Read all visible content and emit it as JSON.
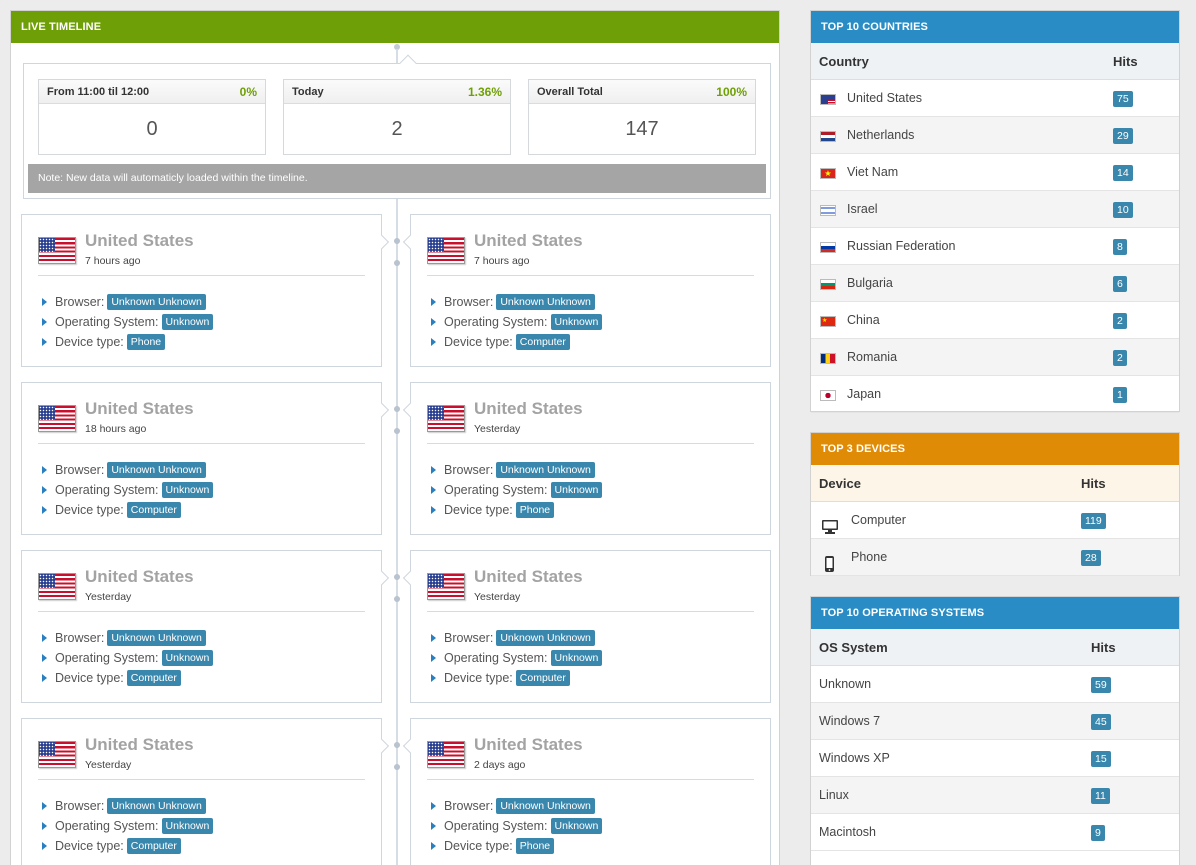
{
  "timeline": {
    "title": "LIVE TIMELINE",
    "stats": [
      {
        "label": "From 11:00 til 12:00",
        "percent": "0%",
        "value": "0"
      },
      {
        "label": "Today",
        "percent": "1.36%",
        "value": "2"
      },
      {
        "label": "Overall Total",
        "percent": "100%",
        "value": "147"
      }
    ],
    "note": "Note: New data will automaticly loaded within the timeline.",
    "field_labels": {
      "browser": "Browser:",
      "os": "Operating System:",
      "device": "Device type:"
    },
    "flag_icon": "us-flag-icon",
    "visits": [
      {
        "country": "United States",
        "time": "7 hours ago",
        "browser": "Unknown Unknown",
        "os": "Unknown",
        "device": "Phone"
      },
      {
        "country": "United States",
        "time": "7 hours ago",
        "browser": "Unknown Unknown",
        "os": "Unknown",
        "device": "Computer"
      },
      {
        "country": "United States",
        "time": "18 hours ago",
        "browser": "Unknown Unknown",
        "os": "Unknown",
        "device": "Computer"
      },
      {
        "country": "United States",
        "time": "Yesterday",
        "browser": "Unknown Unknown",
        "os": "Unknown",
        "device": "Phone"
      },
      {
        "country": "United States",
        "time": "Yesterday",
        "browser": "Unknown Unknown",
        "os": "Unknown",
        "device": "Computer"
      },
      {
        "country": "United States",
        "time": "Yesterday",
        "browser": "Unknown Unknown",
        "os": "Unknown",
        "device": "Computer"
      },
      {
        "country": "United States",
        "time": "Yesterday",
        "browser": "Unknown Unknown",
        "os": "Unknown",
        "device": "Computer"
      },
      {
        "country": "United States",
        "time": "2 days ago",
        "browser": "Unknown Unknown",
        "os": "Unknown",
        "device": "Phone"
      }
    ]
  },
  "countries": {
    "title": "TOP 10 COUNTRIES",
    "col_name": "Country",
    "col_hits": "Hits",
    "rows": [
      {
        "name": "United States",
        "hits": "75",
        "flag": "us"
      },
      {
        "name": "Netherlands",
        "hits": "29",
        "flag": "nl"
      },
      {
        "name": "Viet Nam",
        "hits": "14",
        "flag": "vn"
      },
      {
        "name": "Israel",
        "hits": "10",
        "flag": "il"
      },
      {
        "name": "Russian Federation",
        "hits": "8",
        "flag": "ru"
      },
      {
        "name": "Bulgaria",
        "hits": "6",
        "flag": "bg"
      },
      {
        "name": "China",
        "hits": "2",
        "flag": "cn"
      },
      {
        "name": "Romania",
        "hits": "2",
        "flag": "ro"
      },
      {
        "name": "Japan",
        "hits": "1",
        "flag": "jp"
      }
    ]
  },
  "devices": {
    "title": "TOP 3 DEVICES",
    "col_name": "Device",
    "col_hits": "Hits",
    "rows": [
      {
        "name": "Computer",
        "hits": "119",
        "icon": "monitor-icon"
      },
      {
        "name": "Phone",
        "hits": "28",
        "icon": "phone-icon"
      }
    ]
  },
  "os": {
    "title": "TOP 10 OPERATING SYSTEMS",
    "col_name": "OS System",
    "col_hits": "Hits",
    "rows": [
      {
        "name": "Unknown",
        "hits": "59"
      },
      {
        "name": "Windows 7",
        "hits": "45"
      },
      {
        "name": "Windows XP",
        "hits": "15"
      },
      {
        "name": "Linux",
        "hits": "11"
      },
      {
        "name": "Macintosh",
        "hits": "9"
      }
    ]
  },
  "colors": {
    "timeline_header": "#6f9f06",
    "countries_header": "#2a8cc4",
    "devices_header": "#e08b05",
    "os_header": "#2a8cc4",
    "badge": "#3a87ad",
    "percent": "#6f9f06"
  }
}
